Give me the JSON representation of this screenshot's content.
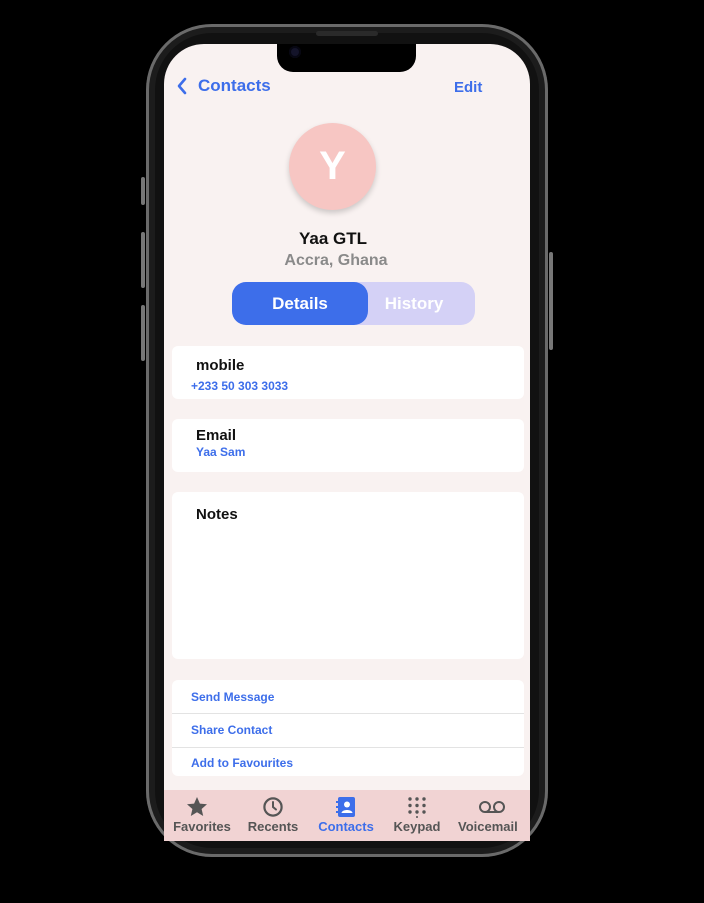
{
  "nav": {
    "back_label": "Contacts",
    "edit_label": "Edit"
  },
  "contact": {
    "initial": "Y",
    "name": "Yaa GTL",
    "location": "Accra, Ghana"
  },
  "segmented": {
    "active": "Details",
    "inactive": "History"
  },
  "fields": {
    "mobile": {
      "label": "mobile",
      "value": "+233 50 303 3033"
    },
    "email": {
      "label": "Email",
      "value": "Yaa Sam"
    },
    "notes": {
      "label": "Notes"
    }
  },
  "actions": [
    "Send Message",
    "Share Contact",
    "Add to Favourites"
  ],
  "tabs": [
    {
      "label": "Favorites",
      "icon": "star-icon"
    },
    {
      "label": "Recents",
      "icon": "clock-icon"
    },
    {
      "label": "Contacts",
      "icon": "contacts-book-icon",
      "active": true
    },
    {
      "label": "Keypad",
      "icon": "keypad-icon"
    },
    {
      "label": "Voicemail",
      "icon": "voicemail-icon"
    }
  ],
  "colors": {
    "accent": "#3d6eea",
    "avatar": "#f7c6c3",
    "segment_bg": "#d4d1f6",
    "tabbar": "#f1d3d3",
    "screen_bg": "#f9f2f1"
  }
}
